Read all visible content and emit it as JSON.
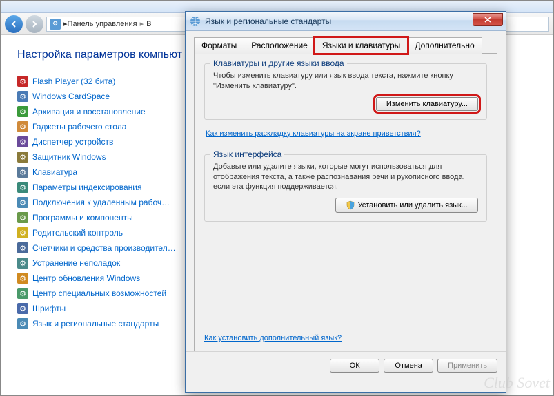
{
  "bg": {
    "breadcrumb": {
      "item1": "Панель управления",
      "item2": "В"
    },
    "heading": "Настройка параметров компьют",
    "items": [
      {
        "label": "Flash Player (32 бита)",
        "color": "#c62828"
      },
      {
        "label": "Windows CardSpace",
        "color": "#4a7bb5"
      },
      {
        "label": "Архивация и восстановление",
        "color": "#3a9a3a"
      },
      {
        "label": "Гаджеты рабочего стола",
        "color": "#d08a3a"
      },
      {
        "label": "Диспетчер устройств",
        "color": "#6a4a9a"
      },
      {
        "label": "Защитник Windows",
        "color": "#8a7a3a"
      },
      {
        "label": "Клавиатура",
        "color": "#5a7a9a"
      },
      {
        "label": "Параметры индексирования",
        "color": "#3a8a7a"
      },
      {
        "label": "Подключения к удаленным рабоч…",
        "color": "#4a8ab5"
      },
      {
        "label": "Программы и компоненты",
        "color": "#6a9a4a"
      },
      {
        "label": "Родительский контроль",
        "color": "#d0b020"
      },
      {
        "label": "Счетчики и средства производител…",
        "color": "#4a6a9a"
      },
      {
        "label": "Устранение неполадок",
        "color": "#4a8a8a"
      },
      {
        "label": "Центр обновления Windows",
        "color": "#d08a20"
      },
      {
        "label": "Центр специальных возможностей",
        "color": "#4a9a6a"
      },
      {
        "label": "Шрифты",
        "color": "#4a6aaa"
      },
      {
        "label": "Язык и региональные стандарты",
        "color": "#4a8ab5"
      }
    ]
  },
  "dialog": {
    "title": "Язык и региональные стандарты",
    "tabs": {
      "formats": "Форматы",
      "location": "Расположение",
      "keyboards": "Языки и клавиатуры",
      "advanced": "Дополнительно"
    },
    "group1": {
      "title": "Клавиатуры и другие языки ввода",
      "text": "Чтобы изменить клавиатуру или язык ввода текста, нажмите кнопку \"Изменить клавиатуру\".",
      "button": "Изменить клавиатуру...",
      "link": "Как изменить раскладку клавиатуры на экране приветствия?"
    },
    "group2": {
      "title": "Язык интерфейса",
      "text": "Добавьте или удалите языки, которые могут использоваться для отображения текста, а также распознавания речи и рукописного ввода, если эта функция поддерживается.",
      "button": "Установить или удалить язык..."
    },
    "bottomLink": "Как установить дополнительный язык?",
    "footer": {
      "ok": "ОК",
      "cancel": "Отмена",
      "apply": "Применить"
    }
  },
  "watermark": "Club Sovet"
}
